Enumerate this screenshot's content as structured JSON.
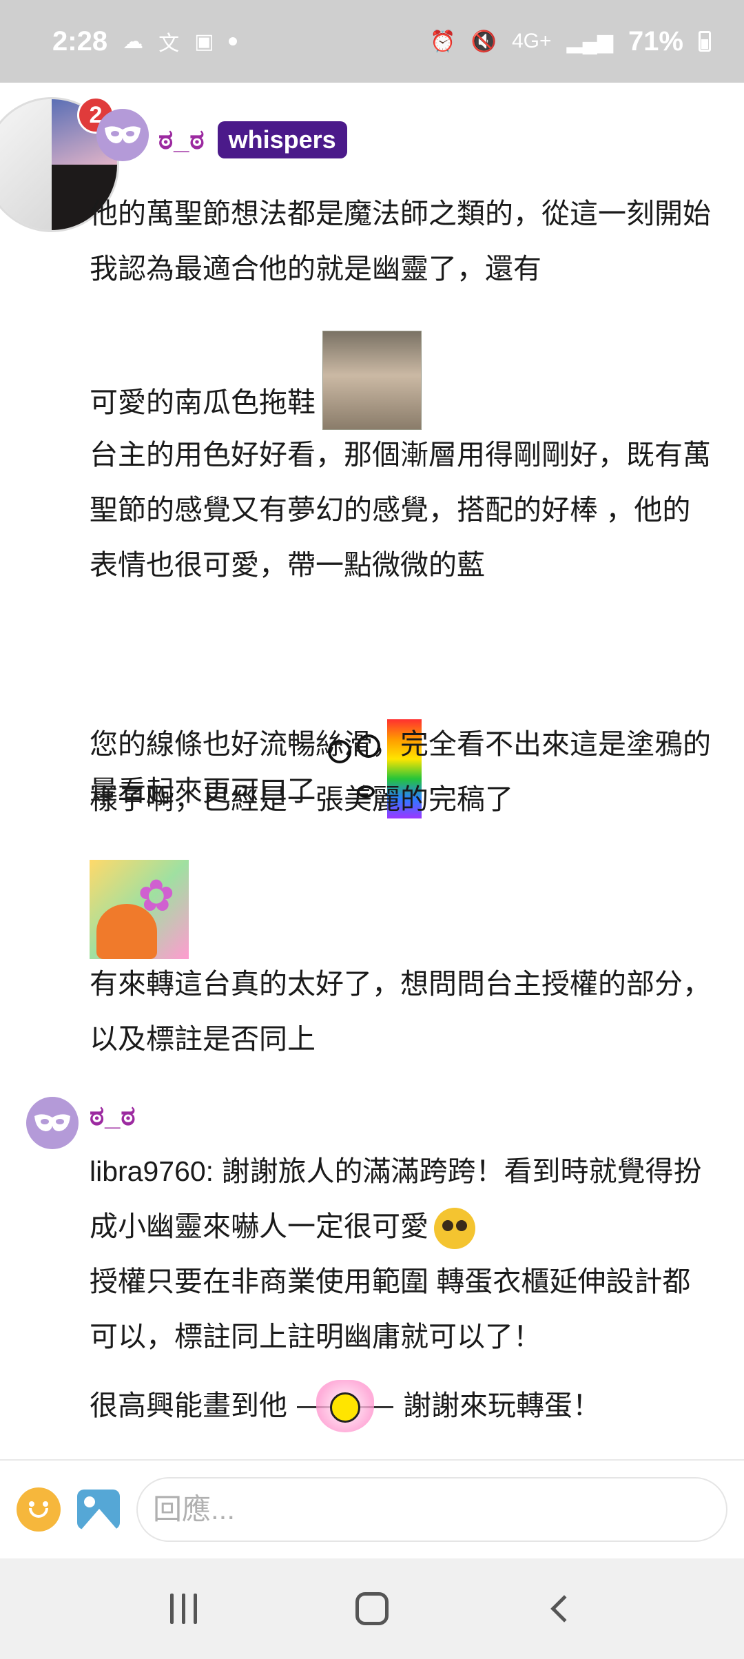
{
  "status_bar": {
    "time": "2:28",
    "battery": "71%",
    "network": "4G+",
    "icons": [
      "weather-icon",
      "translate-icon",
      "gallery-icon",
      "dot-icon",
      "alarm-icon",
      "mute-icon",
      "network-4g-icon",
      "signal-icon",
      "battery-icon"
    ]
  },
  "thread": {
    "notification_count": "2",
    "first_post": {
      "username": "ಠ_ಠ",
      "badge": "whispers",
      "paragraphs": [
        "他的萬聖節想法都是魔法師之類的，從這一刻開始我認為最適合他的就是幽靈了，還有",
        "可愛的南瓜色拖鞋",
        "台主的用色好好看，那個漸層用得剛剛好，既有萬聖節的感覺又有夢幻的感覺，搭配的好棒 ，他的表情也很可愛，帶一點微微的藍",
        "暈看起來更可口了",
        "您的線條也好流暢絲滑，完全看不出來這是塗鴉的樣子啊，已經是一張美麗的完稿了",
        "有來轉這台真的太好了，想問問台主授權的部分，以及標註是否同上"
      ],
      "emotes": [
        "face-photo-emote",
        "meme-face-emote",
        "lotus-fox-emote"
      ]
    },
    "reply_post": {
      "username": "ಠ_ಠ",
      "lines": [
        "libra9760: 謝謝旅人的滿滿跨跨！看到時就覺得扮成小幽靈來嚇人一定很可愛",
        "授權只要在非商業使用範圍 轉蛋衣櫃延伸設計都可以，標註同上註明幽庸就可以了！",
        "很高興能畫到他",
        "謝謝來玩轉蛋！"
      ],
      "emotes": [
        "pleading-face-emote",
        "heart-smiley-emote"
      ]
    }
  },
  "reply_bar": {
    "placeholder": "回應...",
    "value": ""
  },
  "nav_bar": {
    "buttons": [
      "recents",
      "home",
      "back"
    ]
  },
  "colors": {
    "status_bar_bg": "#cfcfcf",
    "username": "#9c2aa0",
    "badge_bg": "#4b1a8a",
    "mask_avatar": "#b49ad8",
    "notification": "#e03b3b"
  }
}
